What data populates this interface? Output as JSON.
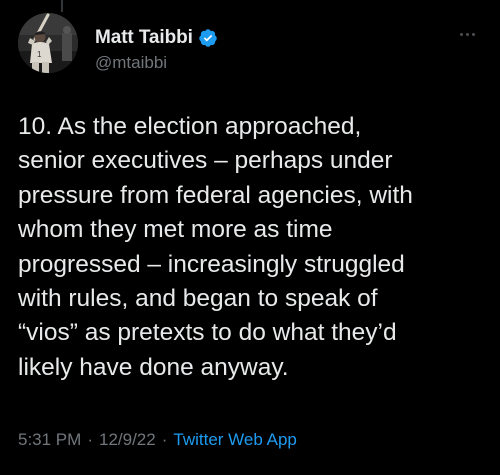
{
  "author": {
    "display_name": "Matt Taibbi",
    "handle": "@mtaibbi",
    "verified": true,
    "avatar_icon": "baseball-player-avatar"
  },
  "tweet": {
    "text": "10.  As the election approached,\nsenior executives – perhaps under\npressure from federal agencies, with\nwhom they met more as time\nprogressed – increasingly struggled\nwith rules, and began to speak of\n“vios” as pretexts to do what they’d\nlikely have done anyway.",
    "time": "5:31 PM",
    "date": "12/9/22",
    "separator": "·",
    "source": "Twitter Web App"
  },
  "colors": {
    "background": "#000000",
    "primary_text": "#e7e9ea",
    "secondary_text": "#71767b",
    "accent": "#1d9bf0"
  }
}
